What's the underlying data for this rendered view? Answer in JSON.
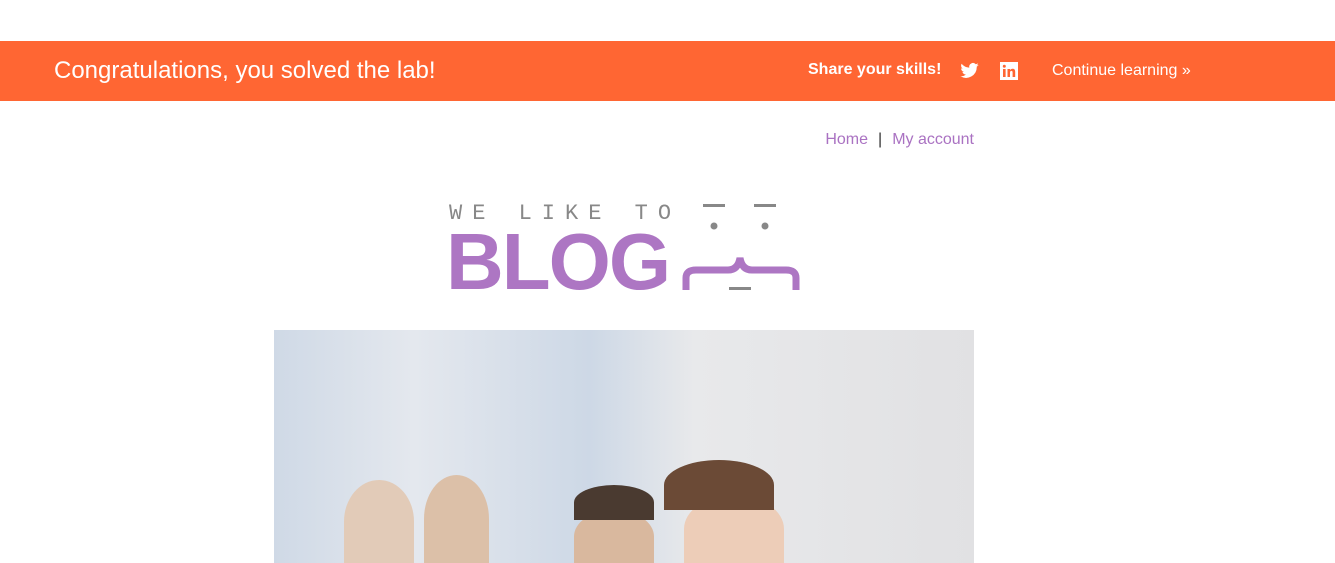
{
  "banner": {
    "title": "Congratulations, you solved the lab!",
    "share_label": "Share your skills!",
    "continue_label": "Continue learning »",
    "color": "#ff6633"
  },
  "nav": {
    "home": "Home",
    "separator": "|",
    "account": "My account",
    "link_color": "#aa72c2"
  },
  "logo": {
    "top": "WE LIKE TO",
    "main": "BLOG"
  },
  "hero": {
    "icon": "blog-post-image"
  }
}
